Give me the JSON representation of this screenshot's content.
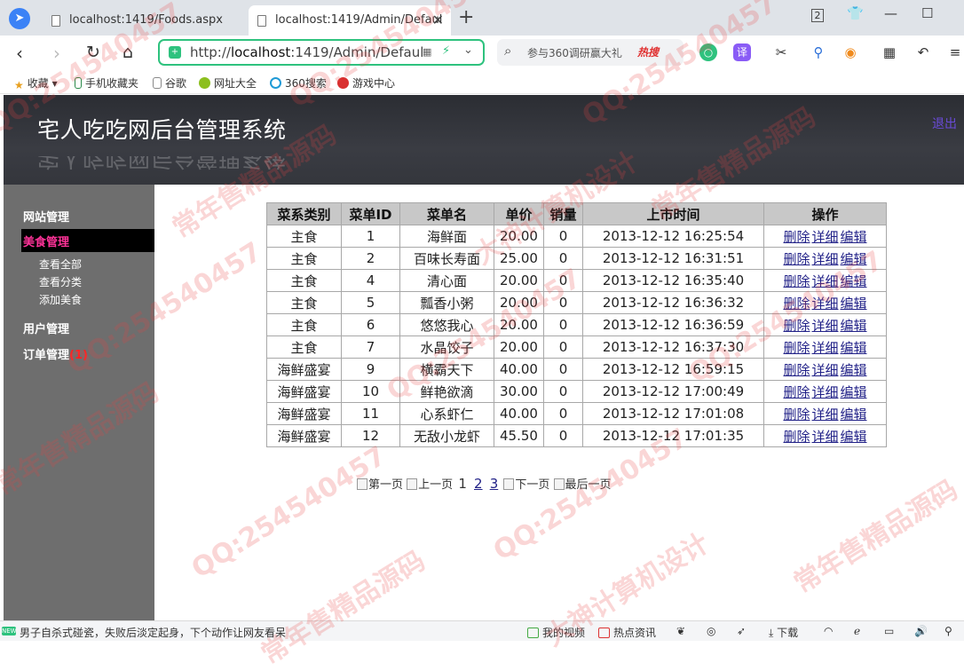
{
  "browser": {
    "tabs": [
      {
        "label": "localhost:1419/Foods.aspx"
      },
      {
        "label": "localhost:1419/Admin/Defaul"
      }
    ],
    "window_badge": "2",
    "url_prefix": "http://",
    "url_host": "localhost",
    "url_rest": ":1419/Admin/Defaul",
    "search_placeholder": "参与360调研赢大礼",
    "search_hot": "热搜",
    "bookmarks": [
      "收藏",
      "手机收藏夹",
      "谷歌",
      "网址大全",
      "360搜索",
      "游戏中心"
    ]
  },
  "header": {
    "title": "宅人吃吃网后台管理系统",
    "right_link": "退出"
  },
  "sidebar": {
    "site_mgmt": "网站管理",
    "food_mgmt": "美食管理",
    "food_items": [
      "查看全部",
      "查看分类",
      "添加美食"
    ],
    "user_mgmt": "用户管理",
    "order_mgmt": "订单管理",
    "order_badge": "(1)"
  },
  "table": {
    "headers": [
      "菜系类别",
      "菜单ID",
      "菜单名",
      "单价",
      "销量",
      "上市时间",
      "操作"
    ],
    "actions": [
      "删除",
      "详细",
      "编辑"
    ],
    "rows": [
      [
        "主食",
        "1",
        "海鲜面",
        "20.00",
        "0",
        "2013-12-12 16:25:54"
      ],
      [
        "主食",
        "2",
        "百味长寿面",
        "25.00",
        "0",
        "2013-12-12 16:31:51"
      ],
      [
        "主食",
        "4",
        "清心面",
        "20.00",
        "0",
        "2013-12-12 16:35:40"
      ],
      [
        "主食",
        "5",
        "瓢香小粥",
        "20.00",
        "0",
        "2013-12-12 16:36:32"
      ],
      [
        "主食",
        "6",
        "悠悠我心",
        "20.00",
        "0",
        "2013-12-12 16:36:59"
      ],
      [
        "主食",
        "7",
        "水晶饺子",
        "20.00",
        "0",
        "2013-12-12 16:37:30"
      ],
      [
        "海鲜盛宴",
        "9",
        "横霸天下",
        "40.00",
        "0",
        "2013-12-12 16:59:15"
      ],
      [
        "海鲜盛宴",
        "10",
        "鲜艳欲滴",
        "30.00",
        "0",
        "2013-12-12 17:00:49"
      ],
      [
        "海鲜盛宴",
        "11",
        "心系虾仁",
        "40.00",
        "0",
        "2013-12-12 17:01:08"
      ],
      [
        "海鲜盛宴",
        "12",
        "无敌小龙虾",
        "45.50",
        "0",
        "2013-12-12 17:01:35"
      ]
    ]
  },
  "pager": {
    "first": "第一页",
    "prev": "上一页",
    "pages": [
      "1",
      "2",
      "3"
    ],
    "next": "下一页",
    "last": "最后一页"
  },
  "statusbar": {
    "news_badge": "NEW",
    "news": "男子自杀式碰瓷，失败后淡定起身，下个动作让网友看呆",
    "video": "我的视频",
    "hot_news": "热点资讯",
    "download": "下载"
  },
  "watermarks": [
    "QQ:254540457",
    "常年售精品源码",
    "大神计算机设计"
  ]
}
